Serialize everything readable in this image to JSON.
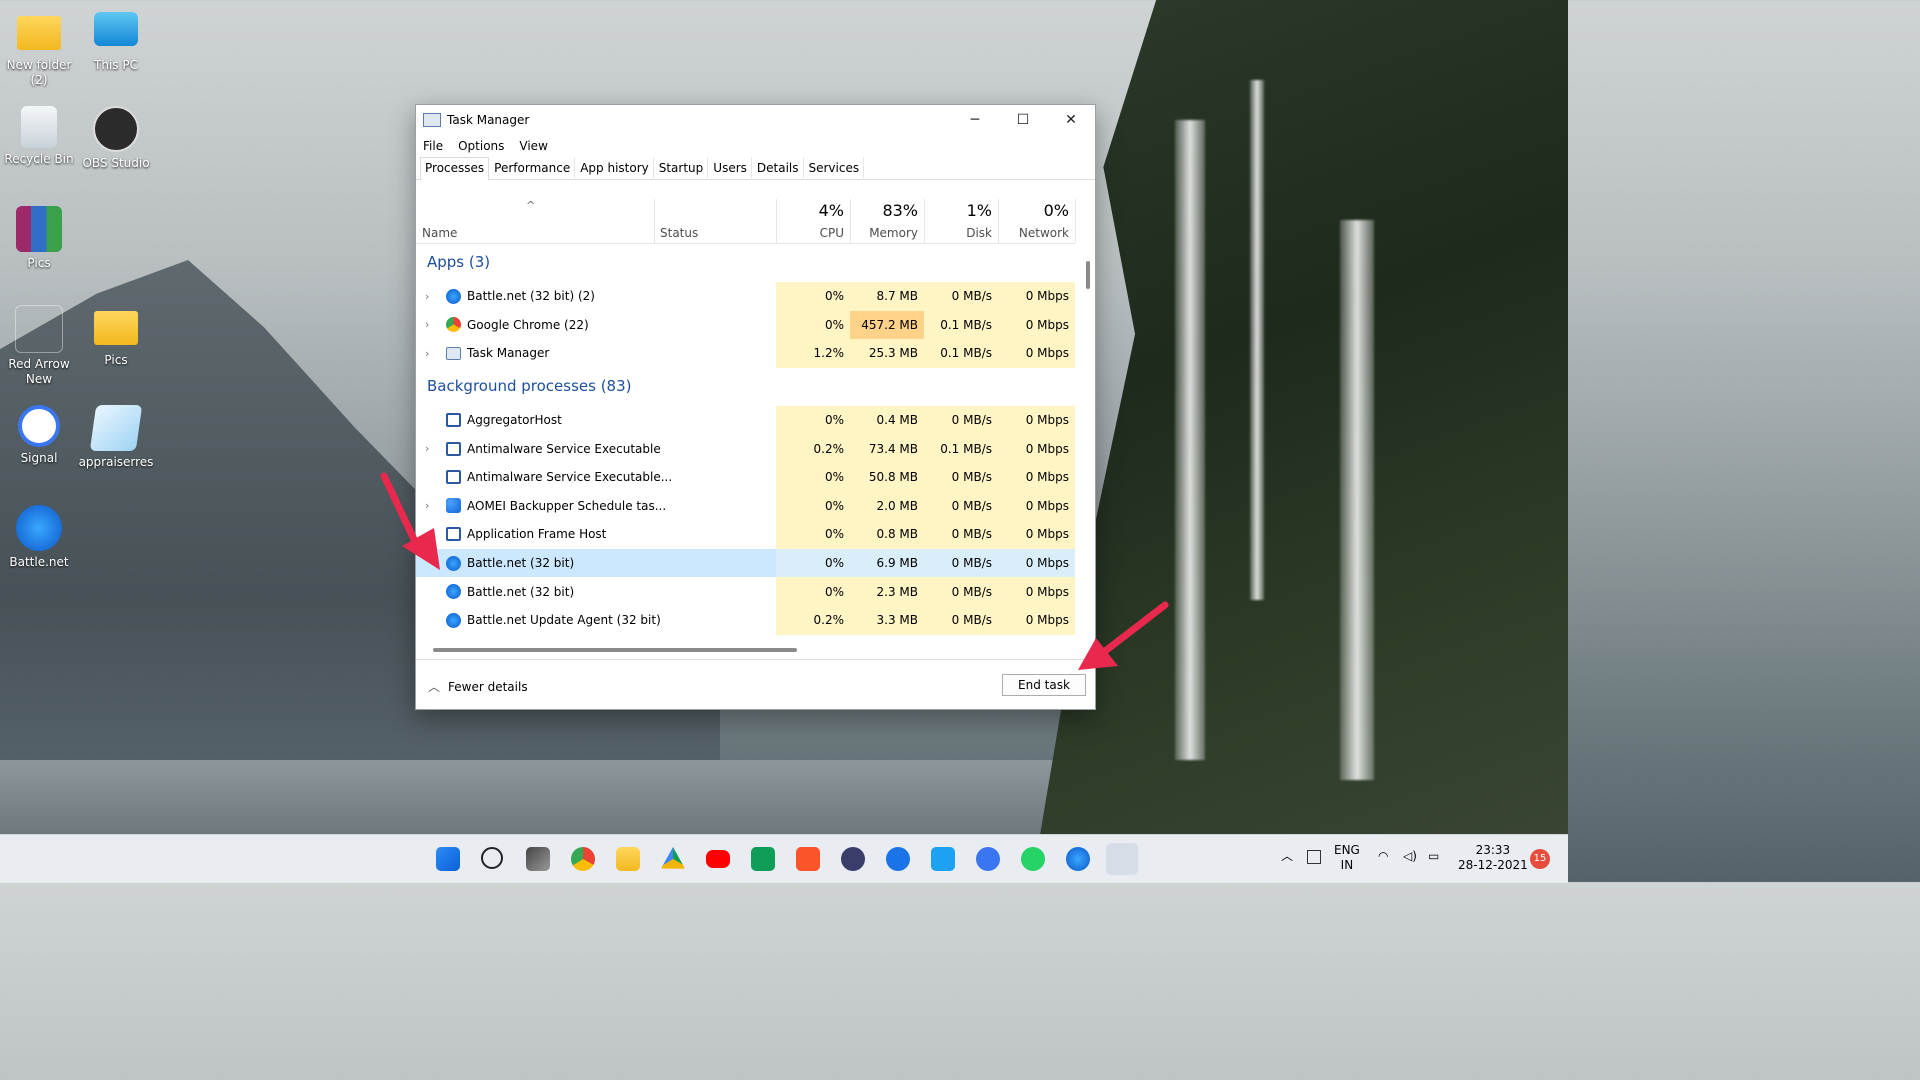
{
  "desktop": {
    "icons": [
      {
        "label": "New folder (2)"
      },
      {
        "label": "This PC"
      },
      {
        "label": "Recycle Bin"
      },
      {
        "label": "OBS Studio"
      },
      {
        "label": "Pics"
      },
      {
        "label": "Red Arrow New"
      },
      {
        "label": "Pics"
      },
      {
        "label": "Signal"
      },
      {
        "label": "appraiserres"
      },
      {
        "label": "Battle.net"
      }
    ]
  },
  "window": {
    "title": "Task Manager",
    "controls": {
      "minimize": "─",
      "maximize": "☐",
      "close": "✕"
    },
    "menu": [
      "File",
      "Options",
      "View"
    ],
    "tabs": [
      "Processes",
      "Performance",
      "App history",
      "Startup",
      "Users",
      "Details",
      "Services"
    ],
    "headers": {
      "sort_indicator": "^",
      "name": "Name",
      "status": "Status",
      "cpu": {
        "pct": "4%",
        "label": "CPU"
      },
      "memory": {
        "pct": "83%",
        "label": "Memory"
      },
      "disk": {
        "pct": "1%",
        "label": "Disk"
      },
      "network": {
        "pct": "0%",
        "label": "Network"
      }
    },
    "groups": {
      "apps": "Apps (3)",
      "background": "Background processes (83)"
    },
    "apps": [
      {
        "name": "Battle.net (32 bit) (2)",
        "cpu": "0%",
        "mem": "8.7 MB",
        "disk": "0 MB/s",
        "net": "0 Mbps"
      },
      {
        "name": "Google Chrome (22)",
        "cpu": "0%",
        "mem": "457.2 MB",
        "disk": "0.1 MB/s",
        "net": "0 Mbps"
      },
      {
        "name": "Task Manager",
        "cpu": "1.2%",
        "mem": "25.3 MB",
        "disk": "0.1 MB/s",
        "net": "0 Mbps"
      }
    ],
    "background": [
      {
        "name": "AggregatorHost",
        "cpu": "0%",
        "mem": "0.4 MB",
        "disk": "0 MB/s",
        "net": "0 Mbps"
      },
      {
        "name": "Antimalware Service Executable",
        "cpu": "0.2%",
        "mem": "73.4 MB",
        "disk": "0.1 MB/s",
        "net": "0 Mbps"
      },
      {
        "name": "Antimalware Service Executable...",
        "cpu": "0%",
        "mem": "50.8 MB",
        "disk": "0 MB/s",
        "net": "0 Mbps"
      },
      {
        "name": "AOMEI Backupper Schedule tas...",
        "cpu": "0%",
        "mem": "2.0 MB",
        "disk": "0 MB/s",
        "net": "0 Mbps"
      },
      {
        "name": "Application Frame Host",
        "cpu": "0%",
        "mem": "0.8 MB",
        "disk": "0 MB/s",
        "net": "0 Mbps"
      },
      {
        "name": "Battle.net (32 bit)",
        "cpu": "0%",
        "mem": "6.9 MB",
        "disk": "0 MB/s",
        "net": "0 Mbps"
      },
      {
        "name": "Battle.net (32 bit)",
        "cpu": "0%",
        "mem": "2.3 MB",
        "disk": "0 MB/s",
        "net": "0 Mbps"
      },
      {
        "name": "Battle.net Update Agent (32 bit)",
        "cpu": "0.2%",
        "mem": "3.3 MB",
        "disk": "0 MB/s",
        "net": "0 Mbps"
      }
    ],
    "footer": {
      "fewer_details": "Fewer details",
      "end_task": "End task"
    }
  },
  "taskbar": {
    "tray": {
      "lang1": "ENG",
      "lang2": "IN",
      "time": "23:33",
      "date": "28-12-2021",
      "notifications": "15"
    }
  },
  "colors": {
    "accent": "#1e4fa0",
    "selected_row": "#cce8ff",
    "heat_low": "#fff4c4",
    "heat_mid": "#ffd28a",
    "arrow": "#e8284c"
  }
}
